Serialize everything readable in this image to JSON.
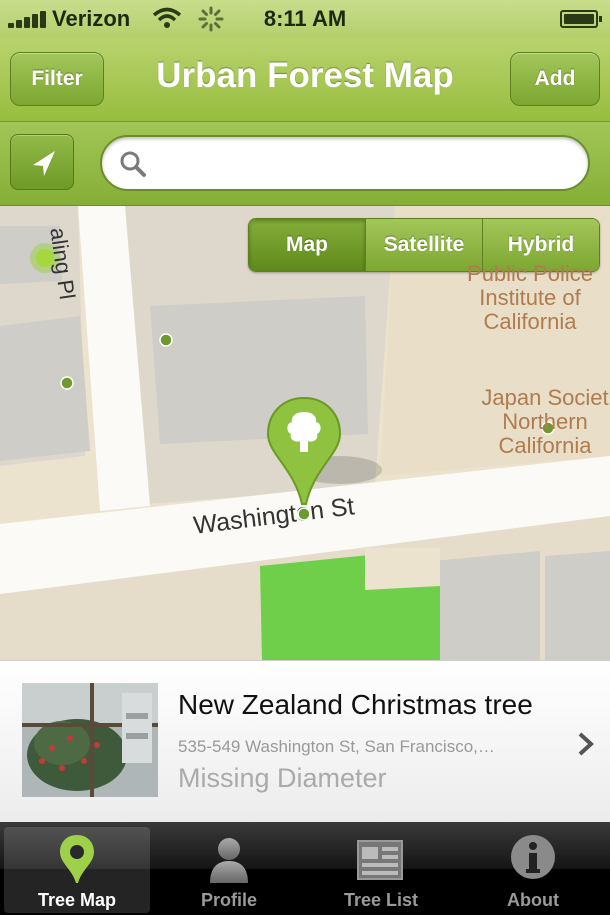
{
  "status_bar": {
    "carrier": "Verizon",
    "time": "8:11 AM"
  },
  "nav": {
    "title": "Urban Forest Map",
    "left_button": "Filter",
    "right_button": "Add"
  },
  "search": {
    "placeholder": "",
    "value": ""
  },
  "map": {
    "map_type_options": [
      "Map",
      "Satellite",
      "Hybrid"
    ],
    "selected_type": "Map",
    "street_labels": [
      "Washington St",
      "aling Pl"
    ],
    "poi_labels": [
      "Public Police\nInstitute of\nCalifornia",
      "Japan Societ\nNorthern\nCalifornia"
    ],
    "marker_icon": "tree-pin-icon"
  },
  "detail": {
    "name": "New Zealand Christmas tree",
    "address": "535-549 Washington St, San Francisco,…",
    "diameter": "Missing Diameter"
  },
  "tabs": [
    {
      "label": "Tree Map",
      "icon": "map-pin-icon",
      "active": true
    },
    {
      "label": "Profile",
      "icon": "person-icon",
      "active": false
    },
    {
      "label": "Tree List",
      "icon": "list-icon",
      "active": false
    },
    {
      "label": "About",
      "icon": "info-icon",
      "active": false
    }
  ],
  "colors": {
    "accent_green": "#97bd3e",
    "map_background": "#ece3cf",
    "poi_label": "#b07b4e"
  }
}
